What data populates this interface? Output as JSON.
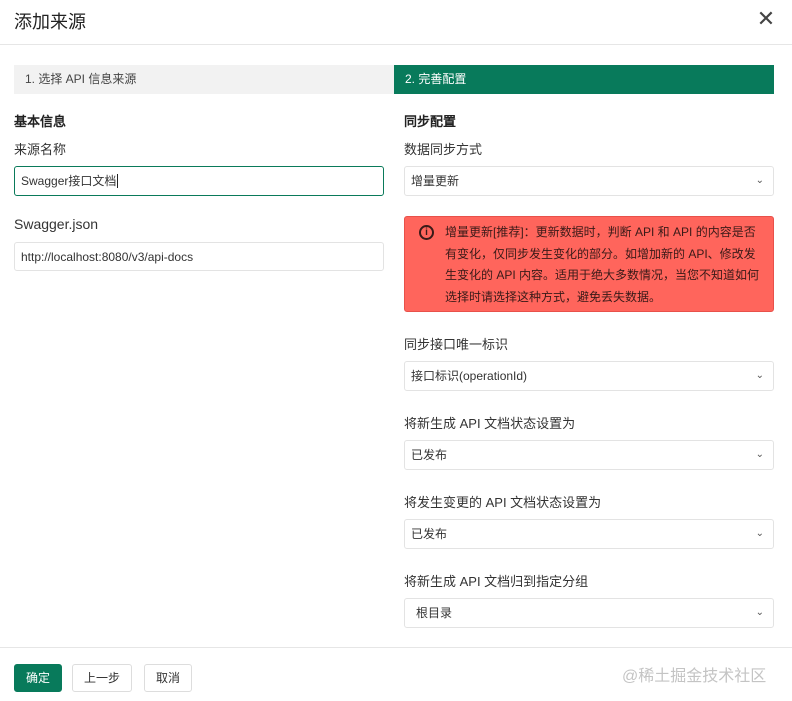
{
  "dialog": {
    "title": "添加来源",
    "close_icon": "close-icon"
  },
  "steps": [
    {
      "label": "1. 选择 API 信息来源"
    },
    {
      "label": "2. 完善配置"
    }
  ],
  "left": {
    "heading": "基本信息",
    "source_name_label": "来源名称",
    "source_name_value": "Swagger接口文档",
    "swagger_label": "Swagger.json",
    "swagger_value": "http://localhost:8080/v3/api-docs"
  },
  "right": {
    "heading": "同步配置",
    "sync_mode_label": "数据同步方式",
    "sync_mode_value": "增量更新",
    "alert_text": "增量更新[推荐]：更新数据时，判断 API 和 API 的内容是否有变化，仅同步发生变化的部分。如增加新的 API、修改发生变化的 API 内容。适用于绝大多数情况，当您不知道如何选择时请选择这种方式，避免丢失数据。",
    "unique_id_label": "同步接口唯一标识",
    "unique_id_value": "接口标识(operationId)",
    "new_status_label": "将新生成 API 文档状态设置为",
    "new_status_value": "已发布",
    "changed_status_label": "将发生变更的 API 文档状态设置为",
    "changed_status_value": "已发布",
    "group_label": "将新生成 API 文档归到指定分组",
    "group_value": "根目录"
  },
  "footer": {
    "confirm": "确定",
    "prev": "上一步",
    "cancel": "取消",
    "watermark": "@稀土掘金技术社区"
  },
  "colors": {
    "accent": "#087a5b",
    "alert": "#ff655c"
  }
}
